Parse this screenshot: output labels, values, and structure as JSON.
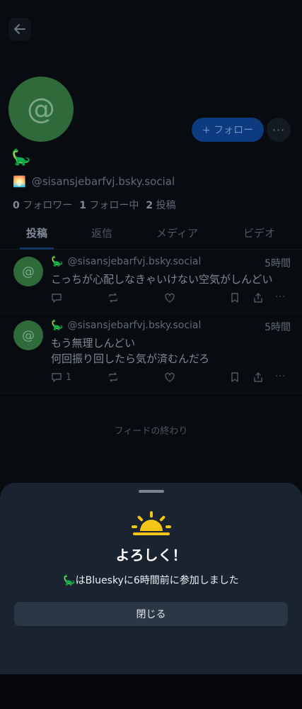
{
  "profile": {
    "avatar_glyph": "@",
    "display_name": "🦕",
    "handle_emoji": "🌅",
    "handle": "@sisansjebarfvj.bsky.social",
    "follow_label": "+ フォロー",
    "more_label": "···",
    "followers_count": "0",
    "followers_label": "フォロワー",
    "following_count": "1",
    "following_label": "フォロー中",
    "posts_count": "2",
    "posts_label": "投稿"
  },
  "tabs": [
    {
      "label": "投稿",
      "active": true
    },
    {
      "label": "返信",
      "active": false
    },
    {
      "label": "メディア",
      "active": false
    },
    {
      "label": "ビデオ",
      "active": false
    }
  ],
  "posts": [
    {
      "author_emoji": "🦕",
      "handle": "@sisansjebarfvj.bsky.social",
      "time": "5時間",
      "lines": [
        "こっちが心配しなきゃいけない空気がしんどい"
      ],
      "reply_count": ""
    },
    {
      "author_emoji": "🦕",
      "handle": "@sisansjebarfvj.bsky.social",
      "time": "5時間",
      "lines": [
        "もう無理しんどい",
        "何回振り回したら気が済むんだろ"
      ],
      "reply_count": "1"
    }
  ],
  "feed_end": "フィードの終わり",
  "sheet": {
    "title": "よろしく！",
    "message": "🦕はBlueskyに6時間前に参加しました",
    "close_label": "閉じる",
    "sun_color": "#f5c518"
  }
}
